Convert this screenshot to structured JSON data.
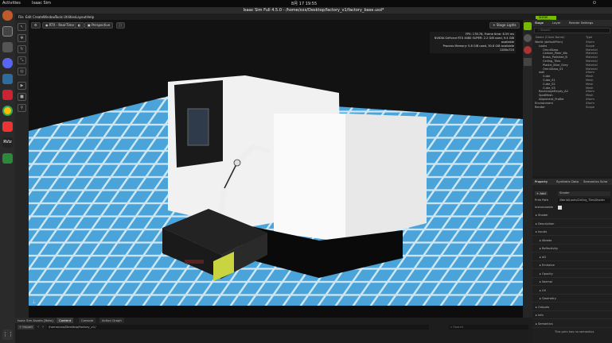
{
  "topbar": {
    "activities": "Activities",
    "app": "Isaac Sim",
    "clock": "8月 17 19:55"
  },
  "window": {
    "title": "Isaac Sim Full 4.5.0 - /home/xxx/Desktop/factory_v1/factory_base.usd*"
  },
  "menu": {
    "items": [
      "File",
      "Edit",
      "Create",
      "Window",
      "Tools",
      "Utilities",
      "Layout",
      "Help"
    ],
    "live": "LIVE",
    "cache": "CACHE:",
    "cache_status": "SHOW VERSION SELECTION"
  },
  "viewport": {
    "camera_mode": "RTX - Real-Time",
    "perspective": "Perspective",
    "stage_lights": "Stage Lights",
    "stats": [
      "FPS: 178.78, Frame time: 6.59 ms",
      "NVIDIA GeForce RTX 4080 SUPER: 2.2 GiB used, 9.4 GiB available",
      "Process Memory: 5.8 GiB used, 30.8 GiB available",
      "1280x720"
    ]
  },
  "stage": {
    "tabs": [
      "Stage",
      "Layer",
      "Render Settings"
    ],
    "search_placeholder": "Search",
    "col_name": "Name (Clone Name)",
    "col_type": "Type",
    "tree": [
      {
        "name": "World (defaultPrim)",
        "type": "Xform",
        "d": 0
      },
      {
        "name": "Looks",
        "type": "Scope",
        "d": 1
      },
      {
        "name": "OmniGlass",
        "type": "Material",
        "d": 2
      },
      {
        "name": "Carbon_Fiber_Wo",
        "type": "Material",
        "d": 2
      },
      {
        "name": "Brass_Polished_B",
        "type": "Material",
        "d": 2
      },
      {
        "name": "Ceiling_Tiles",
        "type": "Material",
        "d": 2
      },
      {
        "name": "Plastic_Blue_Grey",
        "type": "Material",
        "d": 2
      },
      {
        "name": "OmniGlass_01",
        "type": "Material",
        "d": 2
      },
      {
        "name": "wall",
        "type": "Xform",
        "d": 1
      },
      {
        "name": "Cube",
        "type": "Mesh",
        "d": 2
      },
      {
        "name": "Cube_01",
        "type": "Mesh",
        "d": 2
      },
      {
        "name": "Cube_02",
        "type": "Mesh",
        "d": 2
      },
      {
        "name": "Cube_03",
        "type": "Mesh",
        "d": 2
      },
      {
        "name": "RackLargeEmpty_A2",
        "type": "Xform",
        "d": 1
      },
      {
        "name": "SpotMesh",
        "type": "Mesh",
        "d": 1
      },
      {
        "name": "Alignment_Profile",
        "type": "Xform",
        "d": 1
      },
      {
        "name": "Environment",
        "type": "Xform",
        "d": 0
      },
      {
        "name": "Render",
        "type": "Scope",
        "d": 0
      }
    ]
  },
  "property": {
    "tabs": [
      "Property",
      "Synthetic Data",
      "Semantics Sche"
    ],
    "add": "+ Add",
    "add_value": "Shader",
    "prim_path_label": "Prim Path",
    "prim_path": "/World/Looks/Ceiling_Tiles/Shader",
    "instanceable": "Instanceable",
    "sections": [
      "Shader",
      "Description",
      "Inputs",
      "Albedo",
      "Reflectivity",
      "AO",
      "Emissive",
      "Opacity",
      "Normal",
      "UV",
      "Geometry",
      "Outputs",
      "Info",
      "Semantics"
    ],
    "note": "This prim has no semantics"
  },
  "bottom": {
    "tabs": [
      "Isaac Sim Assets [Beta]",
      "Content",
      "Console",
      "Action Graph"
    ],
    "import": "+ Import",
    "path": "/home/xxx/Desktop/factory_v1/",
    "search_placeholder": "Search"
  },
  "colors": {
    "accent": "#76b900",
    "tile": "#4aa3d9",
    "grout": "#cfe7f3",
    "machine": "#e8e8e8"
  }
}
